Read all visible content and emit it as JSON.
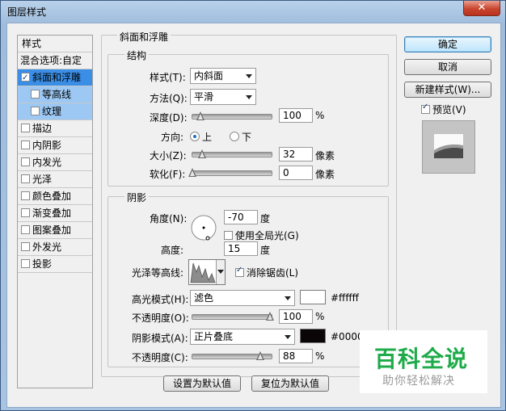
{
  "window": {
    "title": "图层样式",
    "close_glyph": "✕"
  },
  "left_list": {
    "header": "样式",
    "items": [
      {
        "label": "混合选项:自定",
        "checkbox": false,
        "checked": false
      },
      {
        "label": "斜面和浮雕",
        "checkbox": true,
        "checked": true
      },
      {
        "label": "等高线",
        "checkbox": true,
        "checked": false
      },
      {
        "label": "纹理",
        "checkbox": true,
        "checked": false
      },
      {
        "label": "描边",
        "checkbox": true,
        "checked": false
      },
      {
        "label": "内阴影",
        "checkbox": true,
        "checked": false
      },
      {
        "label": "内发光",
        "checkbox": true,
        "checked": false
      },
      {
        "label": "光泽",
        "checkbox": true,
        "checked": false
      },
      {
        "label": "颜色叠加",
        "checkbox": true,
        "checked": false
      },
      {
        "label": "渐变叠加",
        "checkbox": true,
        "checked": false
      },
      {
        "label": "图案叠加",
        "checkbox": true,
        "checked": false
      },
      {
        "label": "外发光",
        "checkbox": true,
        "checked": false
      },
      {
        "label": "投影",
        "checkbox": true,
        "checked": false
      }
    ]
  },
  "bevel": {
    "group_title": "斜面和浮雕",
    "structure_title": "结构",
    "style_label": "样式(T):",
    "style_value": "内斜面",
    "technique_label": "方法(Q):",
    "technique_value": "平滑",
    "depth_label": "深度(D):",
    "depth_value": "100",
    "depth_unit": "%",
    "depth_level": 0.1,
    "direction_label": "方向:",
    "dir_up": "上",
    "dir_down": "下",
    "size_label": "大小(Z):",
    "size_value": "32",
    "size_unit": "像素",
    "size_level": 0.13,
    "soften_label": "软化(F):",
    "soften_value": "0",
    "soften_unit": "像素",
    "soften_level": 0.0
  },
  "shading": {
    "title": "阴影",
    "angle_label": "角度(N):",
    "angle_value": "-70",
    "angle_unit": "度",
    "global_light_label": "使用全局光(G)",
    "altitude_label": "高度:",
    "altitude_value": "15",
    "altitude_unit": "度",
    "gloss_label": "光泽等高线:",
    "antialias_label": "消除锯齿(L)",
    "highlight_mode_label": "高光模式(H):",
    "highlight_mode_value": "滤色",
    "highlight_color_text": "#ffffff",
    "highlight_color": "#ffffff",
    "highlight_opacity_label": "不透明度(O):",
    "highlight_opacity_value": "100",
    "highlight_opacity_unit": "%",
    "highlight_opacity_level": 1.0,
    "shadow_mode_label": "阴影模式(A):",
    "shadow_mode_value": "正片叠底",
    "shadow_color_text": "#0000",
    "shadow_color": "#0a0506",
    "shadow_opacity_label": "不透明度(C):",
    "shadow_opacity_value": "88",
    "shadow_opacity_unit": "%",
    "shadow_opacity_level": 0.88
  },
  "bottom": {
    "make_default": "设置为默认值",
    "reset_default": "复位为默认值"
  },
  "right": {
    "ok": "确定",
    "cancel": "取消",
    "new_style": "新建样式(W)...",
    "preview": "预览(V)"
  },
  "watermark": {
    "brand": "百科全说",
    "slogan": "助你轻松解决"
  }
}
